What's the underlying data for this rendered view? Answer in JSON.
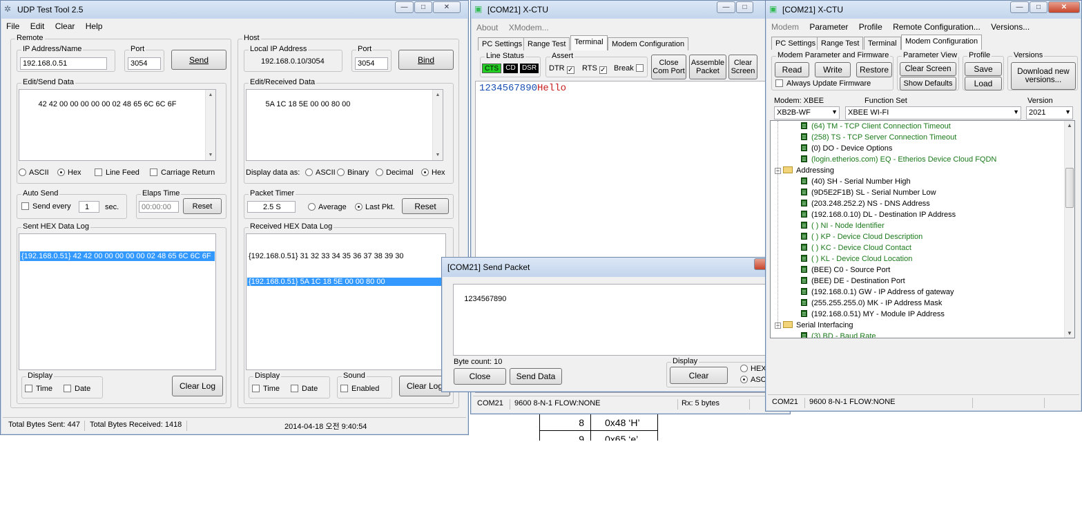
{
  "udp": {
    "title": "UDP Test Tool 2.5",
    "menu": [
      "File",
      "Edit",
      "Clear",
      "Help"
    ],
    "remote": {
      "group": "Remote",
      "ip_group": "IP Address/Name",
      "ip": "192.168.0.51",
      "port_group": "Port",
      "port": "3054",
      "send_btn": "Send",
      "send_group": "Edit/Send Data",
      "send_data": "42 42 00 00 00 00 00 02 48 65 6C 6C 6F",
      "ascii": "ASCII",
      "hex": "Hex",
      "line_feed": "Line Feed",
      "carriage_return": "Carriage Return",
      "auto_group": "Auto Send",
      "send_every": "Send every",
      "every_value": "1",
      "sec": "sec.",
      "elaps_group": "Elaps Time",
      "elaps_value": "00:00:00",
      "reset": "Reset",
      "log_group": "Sent HEX Data Log",
      "log": [
        "{192.168.0.51} 42 42 00 00 00 00 00 02 48 65 6C 6C 6F"
      ],
      "display_group": "Display",
      "time": "Time",
      "date": "Date",
      "clear_log": "Clear Log"
    },
    "host": {
      "group": "Host",
      "ip_group": "Local IP Address",
      "ip": "192.168.0.10/3054",
      "port_group": "Port",
      "port": "3054",
      "bind_btn": "Bind",
      "recv_group": "Edit/Received Data",
      "recv_data": "5A 1C 18 5E 00 00 80 00",
      "display_as": "Display data as:",
      "ascii": "ASCII",
      "binary": "Binary",
      "decimal": "Decimal",
      "hex": "Hex",
      "timer_group": "Packet Timer",
      "timer_value": "2.5 S",
      "average": "Average",
      "last_pkt": "Last Pkt.",
      "reset": "Reset",
      "log_group": "Received HEX Data Log",
      "log": [
        "{192.168.0.51} 31 32 33 34 35 36 37 38 39 30",
        "{192.168.0.51} 5A 1C 18 5E 00 00 80 00"
      ],
      "display_group": "Display",
      "time": "Time",
      "date": "Date",
      "sound_group": "Sound",
      "enabled": "Enabled",
      "clear_log": "Clear Log"
    },
    "status": {
      "sent": "Total Bytes Sent: 447",
      "received": "Total Bytes Received: 1418",
      "datetime": "2014-04-18 오전 9:40:54"
    }
  },
  "xctu1": {
    "title": "[COM21] X-CTU",
    "menu": [
      "About",
      "XModem..."
    ],
    "tabs": [
      "PC Settings",
      "Range Test",
      "Terminal",
      "Modem Configuration"
    ],
    "line_status": "Line Status",
    "cts": "CTS",
    "cd": "CD",
    "dsr": "DSR",
    "assert": "Assert",
    "dtr": "DTR",
    "rts": "RTS",
    "brk": "Break",
    "close_port": "Close Com Port",
    "assemble": "Assemble Packet",
    "clear_screen": "Clear Screen",
    "term_sent": "1234567890",
    "term_recv": "Hello",
    "status": {
      "port": "COM21",
      "settings": "9600 8-N-1  FLOW:NONE",
      "rx": "Rx: 5 bytes"
    }
  },
  "sendpacket": {
    "title": "[COM21] Send Packet",
    "data": "1234567890",
    "byte_count": "Byte count: 10",
    "close": "Close",
    "send_data": "Send Data",
    "display_group": "Display",
    "clear": "Clear",
    "hex": "HEX",
    "asc": "ASC"
  },
  "xctu2": {
    "title": "[COM21] X-CTU",
    "menu": [
      "Modem",
      "Parameter",
      "Profile",
      "Remote Configuration...",
      "Versions..."
    ],
    "tabs": [
      "PC Settings",
      "Range Test",
      "Terminal",
      "Modem Configuration"
    ],
    "mpf_group": "Modem Parameter and Firmware",
    "read": "Read",
    "write": "Write",
    "restore": "Restore",
    "always_update": "Always Update Firmware",
    "pv_group": "Parameter View",
    "clear_screen": "Clear Screen",
    "show_defaults": "Show Defaults",
    "profile_group": "Profile",
    "save": "Save",
    "load": "Load",
    "versions_group": "Versions",
    "download": "Download new versions...",
    "modem_label": "Modem: XBEE",
    "modem_value": "XB2B-WF",
    "fs_label": "Function Set",
    "fs_value": "XBEE WI-FI",
    "ver_label": "Version",
    "ver_value": "2021",
    "tree": [
      {
        "kind": "param",
        "text": "(64) TM - TCP Client Connection Timeout",
        "green": true
      },
      {
        "kind": "param",
        "text": "(258) TS - TCP Server Connection Timeout",
        "green": true
      },
      {
        "kind": "param",
        "text": "(0) DO - Device Options",
        "green": false
      },
      {
        "kind": "param",
        "text": "(login.etherios.com) EQ - Etherios Device Cloud FQDN",
        "green": true
      },
      {
        "kind": "folder",
        "text": "Addressing"
      },
      {
        "kind": "param",
        "text": "(40) SH - Serial Number High",
        "green": false
      },
      {
        "kind": "param",
        "text": "(9D5E2F1B) SL - Serial Number Low",
        "green": false
      },
      {
        "kind": "param",
        "text": "(203.248.252.2) NS - DNS Address",
        "green": false
      },
      {
        "kind": "param",
        "text": "(192.168.0.10) DL - Destination IP Address",
        "green": false
      },
      {
        "kind": "param",
        "text": "( ) NI - Node Identifier",
        "green": true
      },
      {
        "kind": "param",
        "text": "( ) KP - Device Cloud Description",
        "green": true
      },
      {
        "kind": "param",
        "text": "( ) KC - Device Cloud Contact",
        "green": true
      },
      {
        "kind": "param",
        "text": "( ) KL - Device Cloud Location",
        "green": true
      },
      {
        "kind": "param",
        "text": "(BEE) C0 - Source Port",
        "green": false
      },
      {
        "kind": "param",
        "text": "(BEE) DE - Destination Port",
        "green": false
      },
      {
        "kind": "param",
        "text": "(192.168.0.1) GW - IP Address of gateway",
        "green": false
      },
      {
        "kind": "param",
        "text": "(255.255.255.0) MK - IP Address Mask",
        "green": false
      },
      {
        "kind": "param",
        "text": "(192.168.0.51) MY - Module IP Address",
        "green": false
      },
      {
        "kind": "folder",
        "text": "Serial Interfacing"
      },
      {
        "kind": "param",
        "text": "(3) BD - Baud Rate",
        "green": true
      }
    ],
    "status": {
      "port": "COM21",
      "settings": "9600 8-N-1  FLOW:NONE"
    }
  },
  "background_table": {
    "row1_num": "8",
    "row1_val": "0x48 ‘H’",
    "row2_num": "9",
    "row2_val": "0x65 ‘e’"
  },
  "colors": {
    "cts_on": "#22cc22",
    "selection": "#3399ff",
    "sent_text": "#1a4fb5",
    "recv_text": "#c81e1e"
  }
}
